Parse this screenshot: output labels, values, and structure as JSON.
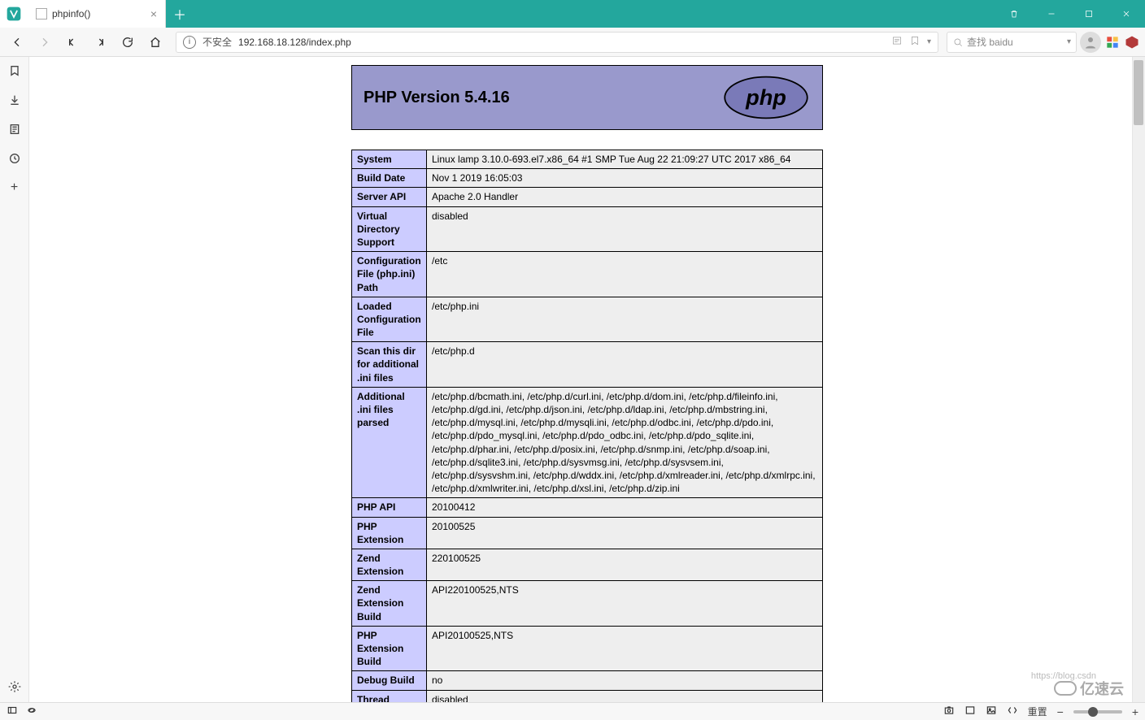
{
  "window": {
    "tab_title": "phpinfo()",
    "insecure_label": "不安全",
    "url": "192.168.18.128/index.php",
    "search_placeholder": "查找 baidu"
  },
  "status": {
    "zoom_label": "重置"
  },
  "watermark": {
    "brand": "亿速云",
    "csdn": "https://blog.csdn"
  },
  "php": {
    "version_title": "PHP Version 5.4.16",
    "rows": [
      {
        "k": "System",
        "v": "Linux lamp 3.10.0-693.el7.x86_64 #1 SMP Tue Aug 22 21:09:27 UTC 2017 x86_64"
      },
      {
        "k": "Build Date",
        "v": "Nov 1 2019 16:05:03"
      },
      {
        "k": "Server API",
        "v": "Apache 2.0 Handler"
      },
      {
        "k": "Virtual Directory Support",
        "v": "disabled"
      },
      {
        "k": "Configuration File (php.ini) Path",
        "v": "/etc"
      },
      {
        "k": "Loaded Configuration File",
        "v": "/etc/php.ini"
      },
      {
        "k": "Scan this dir for additional .ini files",
        "v": "/etc/php.d"
      },
      {
        "k": "Additional .ini files parsed",
        "v": "/etc/php.d/bcmath.ini, /etc/php.d/curl.ini, /etc/php.d/dom.ini, /etc/php.d/fileinfo.ini, /etc/php.d/gd.ini, /etc/php.d/json.ini, /etc/php.d/ldap.ini, /etc/php.d/mbstring.ini, /etc/php.d/mysql.ini, /etc/php.d/mysqli.ini, /etc/php.d/odbc.ini, /etc/php.d/pdo.ini, /etc/php.d/pdo_mysql.ini, /etc/php.d/pdo_odbc.ini, /etc/php.d/pdo_sqlite.ini, /etc/php.d/phar.ini, /etc/php.d/posix.ini, /etc/php.d/snmp.ini, /etc/php.d/soap.ini, /etc/php.d/sqlite3.ini, /etc/php.d/sysvmsg.ini, /etc/php.d/sysvsem.ini, /etc/php.d/sysvshm.ini, /etc/php.d/wddx.ini, /etc/php.d/xmlreader.ini, /etc/php.d/xmlrpc.ini, /etc/php.d/xmlwriter.ini, /etc/php.d/xsl.ini, /etc/php.d/zip.ini"
      },
      {
        "k": "PHP API",
        "v": "20100412"
      },
      {
        "k": "PHP Extension",
        "v": "20100525"
      },
      {
        "k": "Zend Extension",
        "v": "220100525"
      },
      {
        "k": "Zend Extension Build",
        "v": "API220100525,NTS"
      },
      {
        "k": "PHP Extension Build",
        "v": "API20100525,NTS"
      },
      {
        "k": "Debug Build",
        "v": "no"
      },
      {
        "k": "Thread Safety",
        "v": "disabled"
      }
    ]
  }
}
